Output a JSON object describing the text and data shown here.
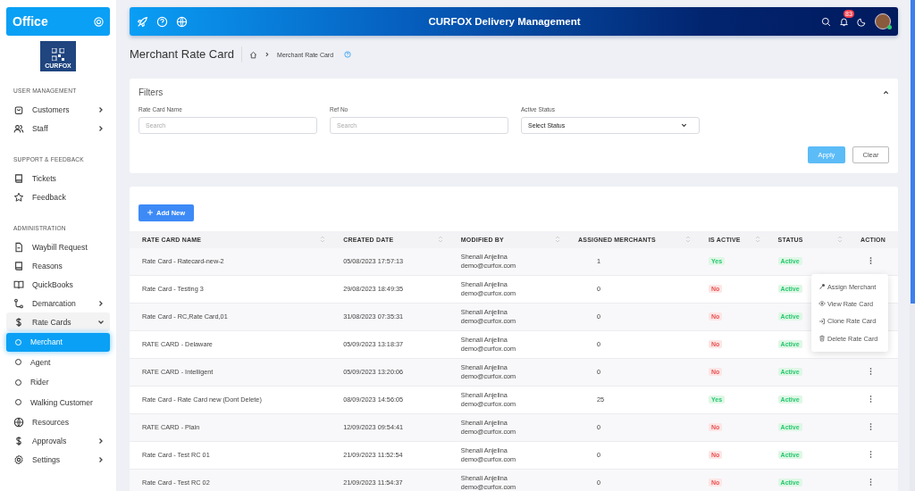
{
  "sidebar": {
    "brand": "Office",
    "logo_text": "CURFOX",
    "groups": [
      {
        "title": "USER MANAGEMENT",
        "items": [
          {
            "label": "Customers",
            "expanded": false
          },
          {
            "label": "Staff",
            "expanded": false
          }
        ]
      },
      {
        "title": "SUPPORT & FEEDBACK",
        "items": [
          {
            "label": "Tickets"
          },
          {
            "label": "Feedback"
          }
        ]
      },
      {
        "title": "ADMINISTRATION",
        "items": [
          {
            "label": "Waybill Request"
          },
          {
            "label": "Reasons"
          },
          {
            "label": "QuickBooks"
          },
          {
            "label": "Demarcation",
            "expanded": false
          },
          {
            "label": "Rate Cards",
            "expanded": true,
            "children": [
              {
                "label": "Merchant",
                "selected": true
              },
              {
                "label": "Agent",
                "selected": false
              },
              {
                "label": "Rider",
                "selected": false
              },
              {
                "label": "Walking Customer",
                "selected": false
              }
            ]
          },
          {
            "label": "Resources"
          },
          {
            "label": "Approvals",
            "expanded": false
          },
          {
            "label": "Settings",
            "expanded": false
          }
        ]
      }
    ]
  },
  "header": {
    "title": "CURFOX Delivery Management",
    "notification_count": "83"
  },
  "page": {
    "title": "Merchant Rate Card",
    "breadcrumb": [
      "Merchant Rate Card"
    ]
  },
  "filters": {
    "title": "Filters",
    "expanded": true,
    "fields": [
      {
        "label": "Rate Card Name",
        "kind": "text",
        "placeholder": "Search"
      },
      {
        "label": "Ref No",
        "kind": "text",
        "placeholder": "Search"
      },
      {
        "label": "Active Status",
        "kind": "select",
        "value": "Select Status"
      }
    ],
    "buttons": [
      {
        "label": "Apply",
        "kind": "primary",
        "disabled": true
      },
      {
        "label": "Clear",
        "kind": "outline",
        "disabled": false
      }
    ]
  },
  "table": {
    "add_button": "Add New",
    "columns": [
      {
        "label": "RATE CARD NAME",
        "sortable": true
      },
      {
        "label": "CREATED DATE",
        "sortable": true
      },
      {
        "label": "MODIFIED BY",
        "sortable": true
      },
      {
        "label": "ASSIGNED MERCHANTS",
        "sortable": true
      },
      {
        "label": "IS ACTIVE",
        "sortable": true
      },
      {
        "label": "STATUS",
        "sortable": true
      },
      {
        "label": "ACTION",
        "sortable": false
      }
    ],
    "rows": [
      {
        "name": "Rate Card - Ratecard-new-2",
        "created": "05/08/2023 17:57:13",
        "modified_name": "Shenali Anjelina",
        "modified_email": "demo@curfox.com",
        "assigned": "1",
        "is_active": {
          "label": "Yes",
          "on": true
        },
        "status": "Active",
        "menu_open": true
      },
      {
        "name": "Rate Card - Testing 3",
        "created": "29/08/2023 18:49:35",
        "modified_name": "Shenali Anjelina",
        "modified_email": "demo@curfox.com",
        "assigned": "0",
        "is_active": {
          "label": "No",
          "on": false
        },
        "status": "Active"
      },
      {
        "name": "Rate Card - RC,Rate Card,01",
        "created": "31/08/2023 07:35:31",
        "modified_name": "Shenali Anjelina",
        "modified_email": "demo@curfox.com",
        "assigned": "0",
        "is_active": {
          "label": "No",
          "on": false
        },
        "status": "Active"
      },
      {
        "name": "RATE CARD - Delaware",
        "created": "05/09/2023 13:18:37",
        "modified_name": "Shenali Anjelina",
        "modified_email": "demo@curfox.com",
        "assigned": "0",
        "is_active": {
          "label": "No",
          "on": false
        },
        "status": "Active"
      },
      {
        "name": "RATE CARD - Intelligent",
        "created": "05/09/2023 13:20:06",
        "modified_name": "Shenali Anjelina",
        "modified_email": "demo@curfox.com",
        "assigned": "0",
        "is_active": {
          "label": "No",
          "on": false
        },
        "status": "Active"
      },
      {
        "name": "Rate Card - Rate Card new (Dont Delete)",
        "created": "08/09/2023 14:56:05",
        "modified_name": "Shenali Anjelina",
        "modified_email": "demo@curfox.com",
        "assigned": "25",
        "is_active": {
          "label": "Yes",
          "on": true
        },
        "status": "Active"
      },
      {
        "name": "RATE CARD - Plain",
        "created": "12/09/2023 09:54:41",
        "modified_name": "Shenali Anjelina",
        "modified_email": "demo@curfox.com",
        "assigned": "0",
        "is_active": {
          "label": "No",
          "on": false
        },
        "status": "Active"
      },
      {
        "name": "Rate Card - Test RC 01",
        "created": "21/09/2023 11:52:54",
        "modified_name": "Shenali Anjelina",
        "modified_email": "demo@curfox.com",
        "assigned": "0",
        "is_active": {
          "label": "No",
          "on": false
        },
        "status": "Active"
      },
      {
        "name": "Rate Card - Test RC 02",
        "created": "21/09/2023 11:54:37",
        "modified_name": "Shenali Anjelina",
        "modified_email": "demo@curfox.com",
        "assigned": "0",
        "is_active": {
          "label": "No",
          "on": false
        },
        "status": "Active"
      }
    ],
    "action_menu": {
      "items": [
        {
          "label": "Assign Merchant"
        },
        {
          "label": "View Rate Card"
        },
        {
          "label": "Clone Rate Card"
        },
        {
          "label": "Delete Rate Card"
        }
      ]
    }
  }
}
